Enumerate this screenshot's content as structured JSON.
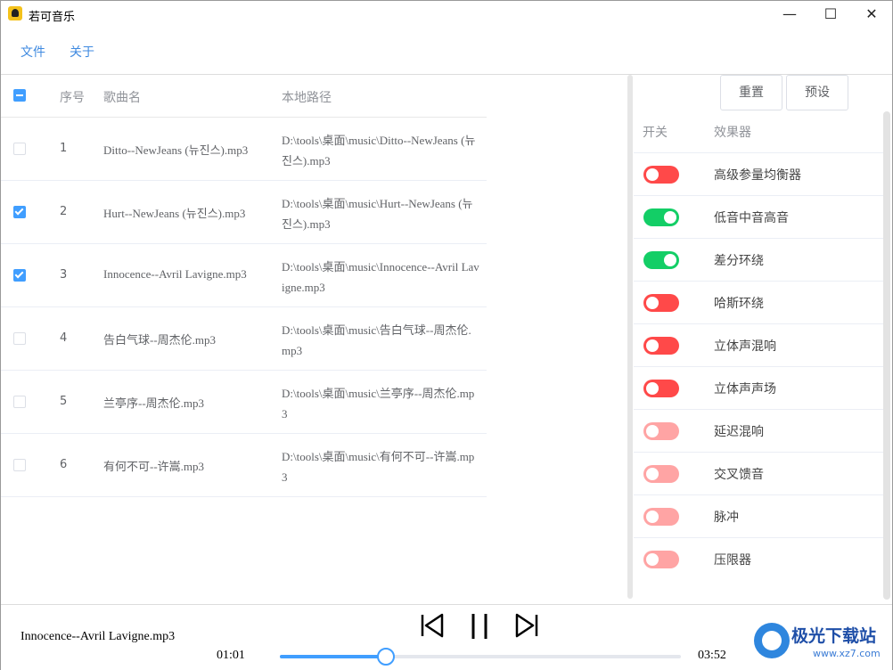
{
  "window": {
    "title": "若可音乐",
    "minimize": "—",
    "maximize": "☐",
    "close": "✕"
  },
  "menu": {
    "items": [
      "文件",
      "关于"
    ]
  },
  "table": {
    "columns": {
      "index": "序号",
      "name": "歌曲名",
      "path": "本地路径"
    },
    "rows": [
      {
        "index": "1",
        "name": "Ditto--NewJeans (뉴진스).mp3",
        "path": "D:\\tools\\桌面\\music\\Ditto--NewJeans (뉴진스).mp3",
        "checked": false
      },
      {
        "index": "2",
        "name": "Hurt--NewJeans (뉴진스).mp3",
        "path": "D:\\tools\\桌面\\music\\Hurt--NewJeans (뉴진스).mp3",
        "checked": true
      },
      {
        "index": "3",
        "name": "Innocence--Avril Lavigne.mp3",
        "path": "D:\\tools\\桌面\\music\\Innocence--Avril Lavigne.mp3",
        "checked": true
      },
      {
        "index": "4",
        "name": "告白气球--周杰伦.mp3",
        "path": "D:\\tools\\桌面\\music\\告白气球--周杰伦.mp3",
        "checked": false
      },
      {
        "index": "5",
        "name": "兰亭序--周杰伦.mp3",
        "path": "D:\\tools\\桌面\\music\\兰亭序--周杰伦.mp3",
        "checked": false
      },
      {
        "index": "6",
        "name": "有何不可--许嵩.mp3",
        "path": "D:\\tools\\桌面\\music\\有何不可--许嵩.mp3",
        "checked": false
      }
    ]
  },
  "effects": {
    "buttons": {
      "reset": "重置",
      "preset": "预设"
    },
    "columns": {
      "switch": "开关",
      "effect": "效果器"
    },
    "items": [
      {
        "name": "高级参量均衡器",
        "on": false
      },
      {
        "name": "低音中音高音",
        "on": true
      },
      {
        "name": "差分环绕",
        "on": true
      },
      {
        "name": "哈斯环绕",
        "on": false
      },
      {
        "name": "立体声混响",
        "on": false
      },
      {
        "name": "立体声声场",
        "on": false
      },
      {
        "name": "延迟混响",
        "on": false,
        "disabled": true
      },
      {
        "name": "交叉馈音",
        "on": false,
        "disabled": true
      },
      {
        "name": "脉冲",
        "on": false,
        "disabled": true
      },
      {
        "name": "压限器",
        "on": false,
        "disabled": true
      }
    ],
    "colors": {
      "on": "#13ce66",
      "off": "#ff4949",
      "disabled_off": "#ffa4a4"
    }
  },
  "player": {
    "now_playing": "Innocence--Avril Lavigne.mp3",
    "current_time": "01:01",
    "total_time": "03:52",
    "progress": 0.263,
    "icons": [
      "previous-icon",
      "pause-icon",
      "next-icon"
    ]
  },
  "watermark": {
    "text": "极光下载站",
    "url": "www.xz7.com"
  }
}
